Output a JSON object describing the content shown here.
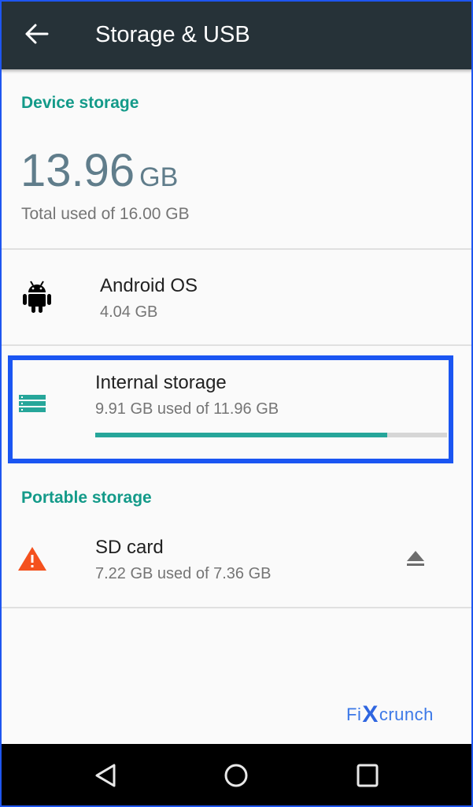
{
  "app_bar": {
    "title": "Storage & USB",
    "back_icon": "arrow-back-icon"
  },
  "device_storage": {
    "header": "Device storage",
    "total_used_value": "13.96",
    "total_used_unit": "GB",
    "total_subtitle": "Total used of 16.00 GB"
  },
  "android_os": {
    "icon": "android-icon",
    "title": "Android OS",
    "size": "4.04 GB"
  },
  "internal_storage": {
    "icon": "storage-icon",
    "title": "Internal storage",
    "usage": "9.91 GB used of 11.96 GB",
    "used_fraction": 0.829,
    "accent_color": "#26a69a"
  },
  "portable_storage": {
    "header": "Portable storage",
    "sd_card": {
      "icon": "warning-icon",
      "title": "SD card",
      "usage": "7.22 GB used of 7.36 GB",
      "action_icon": "eject-icon",
      "warning_color": "#f4511e"
    }
  },
  "watermark": {
    "prefix": "Fi",
    "mark": "X",
    "suffix": "crunch"
  },
  "nav_bar": {
    "buttons": [
      "back",
      "home",
      "recents"
    ]
  },
  "colors": {
    "app_bar": "#263238",
    "section_header": "#139a89",
    "highlight": "#1a55f2"
  }
}
